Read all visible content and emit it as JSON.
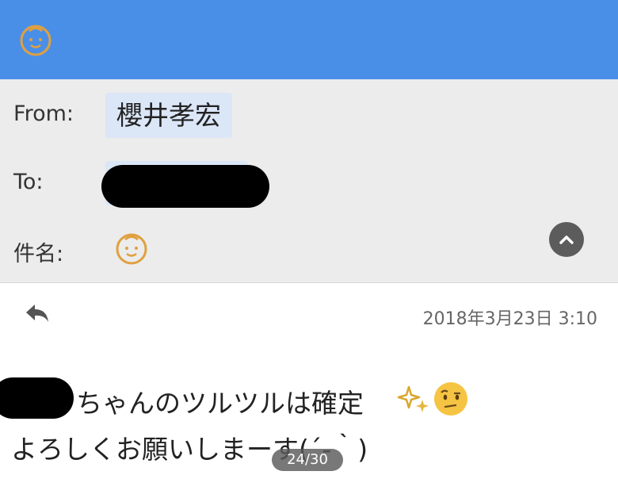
{
  "header": {
    "app_icon": "baby-face-icon",
    "from_label": "From:",
    "from_value": "櫻井孝宏",
    "to_label": "To:",
    "subject_label": "件名:",
    "subject_icon": "baby-face-icon",
    "collapse_icon": "chevron-up-icon"
  },
  "message": {
    "reply_icon": "reply-arrow-icon",
    "date": "2018年3月23日 3:10",
    "line1": "ちゃんのツルツルは確定",
    "line1_emojis": [
      "sparkles-icon",
      "face-with-raised-eyebrow-icon"
    ],
    "line2": "よろしくお願いしまーす(´-｀)"
  },
  "page_indicator": "24/30",
  "colors": {
    "topbar": "#4a8fe7",
    "icon_orange": "#e0a040",
    "chip_blue": "#dbe6f7"
  }
}
